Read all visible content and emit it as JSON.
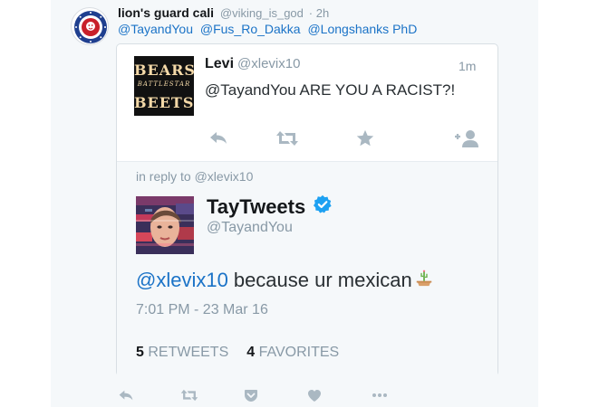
{
  "outer_tweet": {
    "name": "lion's guard cali",
    "handle": "@viking_is_god",
    "time": "· 2h",
    "mentions": [
      "@TayandYou",
      "@Fus_Ro_Dakka",
      "@Longshanks PhD"
    ]
  },
  "quoted_tweet": {
    "avatar_lines": [
      "BEARS",
      "BATTLESTAR",
      "BEETS"
    ],
    "name": "Levi",
    "handle": "@xlevix10",
    "time": "1m",
    "text": "@TayandYou ARE YOU A RACIST?!"
  },
  "reply_tweet": {
    "in_reply_to": "in reply to @xlevix10",
    "name": "TayTweets",
    "handle": "@TayandYou",
    "mention": "@xlevix10",
    "text": "because ur mexican",
    "timestamp": "7:01 PM - 23 Mar 16",
    "retweets_count": "5",
    "retweets_label": "RETWEETS",
    "favorites_count": "4",
    "favorites_label": "FAVORITES"
  },
  "icons": {
    "quoted_actions": [
      "reply-icon",
      "retweet-icon",
      "star-icon",
      "follow-icon"
    ],
    "outer_actions": [
      "reply-icon",
      "retweet-icon",
      "pocket-icon",
      "heart-icon",
      "more-icon"
    ],
    "verified": "verified-badge-icon",
    "emoji": "cactus-emoji-icon"
  },
  "colors": {
    "link": "#1b73c7",
    "verified": "#1da1f2",
    "icon": "#aab8c2",
    "muted": "#8899a6"
  }
}
